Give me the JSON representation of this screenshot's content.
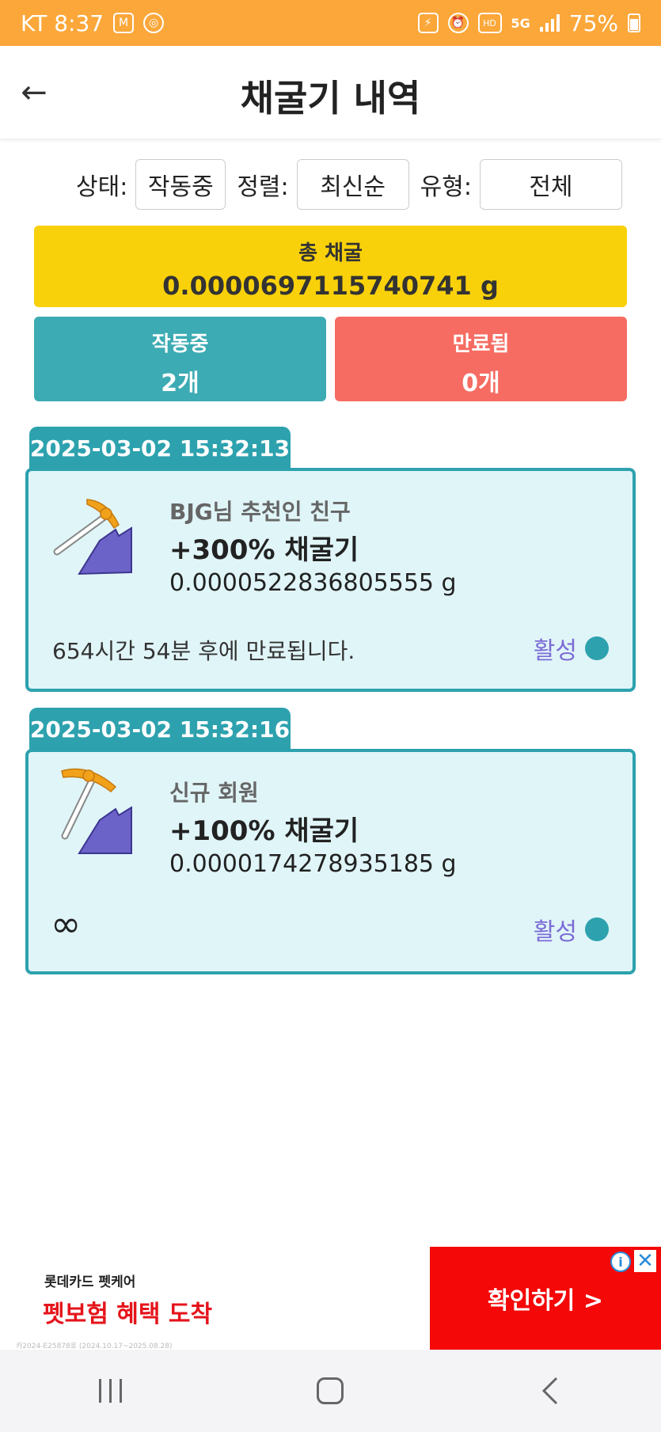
{
  "status_bar": {
    "carrier_time": "KT 8:37",
    "battery": "75%",
    "net_label": "5G",
    "hd_label": "HD"
  },
  "header": {
    "title": "채굴기 내역",
    "back_icon": "arrow-left-icon"
  },
  "filters": {
    "status_label": "상태:",
    "status_value": "작동중",
    "sort_label": "정렬:",
    "sort_value": "최신순",
    "type_label": "유형:",
    "type_value": "전체"
  },
  "summary": {
    "total_label": "총 채굴",
    "total_value": "0.0000697115740741 g",
    "active_label": "작동중",
    "active_count": "2개",
    "expired_label": "만료됨",
    "expired_count": "0개"
  },
  "miners": [
    {
      "date": "2025-03-02 15:32:13",
      "source": "BJG님 추천인 친구",
      "boost": "+300% 채굴기",
      "amount": "0.0000522836805555 g",
      "expiry": "654시간 54분 후에 만료됩니다.",
      "status": "활성"
    },
    {
      "date": "2025-03-02 15:32:16",
      "source": "신규 회원",
      "boost": "+100% 채굴기",
      "amount": "0.0000174278935185 g",
      "expiry": "∞",
      "status": "활성"
    }
  ],
  "ad": {
    "brand": "롯데카드 펫케어",
    "headline": "펫보험 혜택 도착",
    "cta": "확인하기 >",
    "fineprint": "카2024-E25878호 (2024.10.17~2025.08.28)"
  },
  "colors": {
    "status_bar": "#FBA73A",
    "total_box": "#F9D10A",
    "active": "#3CABB3",
    "expired": "#F66C62",
    "card_bg": "#E0F5F8",
    "card_border": "#2DA2AE",
    "status_text": "#7C6BD6",
    "ad_cta": "#F40808"
  }
}
